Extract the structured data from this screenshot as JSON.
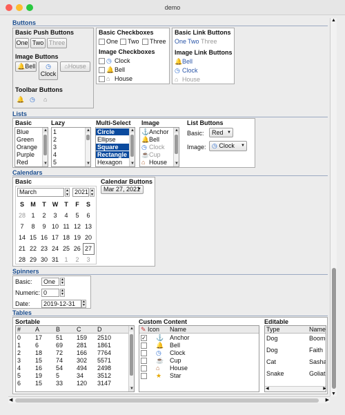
{
  "window": {
    "title": "demo"
  },
  "buttons": {
    "section": "Buttons",
    "push_title": "Basic Push Buttons",
    "one": "One",
    "two": "Two",
    "three": "Three",
    "image_title": "Image Buttons",
    "bell": "Bell",
    "clock": "Clock",
    "house": "House",
    "toolbar_title": "Toolbar Buttons",
    "check_title": "Basic Checkboxes",
    "c_one": "One",
    "c_two": "Two",
    "c_three": "Three",
    "imgcheck_title": "Image Checkboxes",
    "ic_clock": "Clock",
    "ic_bell": "Bell",
    "ic_house": "House",
    "link_title": "Basic Link Buttons",
    "l_one": "One",
    "l_two": "Two",
    "l_three": "Three",
    "imglink_title": "Image Link Buttons",
    "il_bell": "Bell",
    "il_clock": "Clock",
    "il_house": "House"
  },
  "lists": {
    "section": "Lists",
    "basic_title": "Basic",
    "basic_items": [
      "Blue",
      "Green",
      "Orange",
      "Purple",
      "Red"
    ],
    "lazy_title": "Lazy",
    "lazy_items": [
      "1",
      "2",
      "3",
      "4",
      "5"
    ],
    "multi_title": "Multi-Select",
    "multi_items": [
      "Circle",
      "Ellipse",
      "Square",
      "Rectangle",
      "Hexagon"
    ],
    "image_title": "Image",
    "image_items": [
      "Anchor",
      "Bell",
      "Clock",
      "Cup",
      "House"
    ],
    "buttons_title": "List Buttons",
    "basic_label": "Basic:",
    "basic_value": "Red",
    "image_label": "Image:",
    "image_value": "Clock"
  },
  "calendars": {
    "section": "Calendars",
    "basic_title": "Basic",
    "month": "March",
    "year": "2021",
    "days": [
      "S",
      "M",
      "T",
      "W",
      "T",
      "F",
      "S"
    ],
    "weeks": [
      [
        "28",
        "1",
        "2",
        "3",
        "4",
        "5",
        "6"
      ],
      [
        "7",
        "8",
        "9",
        "10",
        "11",
        "12",
        "13"
      ],
      [
        "14",
        "15",
        "16",
        "17",
        "18",
        "19",
        "20"
      ],
      [
        "21",
        "22",
        "23",
        "24",
        "25",
        "26",
        "27"
      ],
      [
        "28",
        "29",
        "30",
        "31",
        "1",
        "2",
        "3"
      ]
    ],
    "btn_title": "Calendar Buttons",
    "btn_value": "Mar 27, 2021"
  },
  "spinners": {
    "section": "Spinners",
    "basic_label": "Basic:",
    "basic_value": "One",
    "numeric_label": "Numeric:",
    "numeric_value": "0",
    "date_label": "Date:",
    "date_value": "2019-12-31"
  },
  "tables": {
    "section": "Tables",
    "sortable_title": "Sortable",
    "sortable_headers": [
      "#",
      "A",
      "B",
      "C",
      "D"
    ],
    "sortable_rows": [
      [
        "0",
        "17",
        "51",
        "159",
        "2510"
      ],
      [
        "1",
        "6",
        "69",
        "281",
        "1861"
      ],
      [
        "2",
        "18",
        "72",
        "166",
        "7764"
      ],
      [
        "3",
        "15",
        "74",
        "302",
        "5571"
      ],
      [
        "4",
        "16",
        "54",
        "494",
        "2498"
      ],
      [
        "5",
        "19",
        "5",
        "34",
        "3512"
      ],
      [
        "6",
        "15",
        "33",
        "120",
        "3147"
      ]
    ],
    "custom_title": "Custom Content",
    "custom_headers": [
      "Icon",
      "Name"
    ],
    "custom_rows": [
      {
        "checked": true,
        "name": "Anchor"
      },
      {
        "checked": false,
        "name": "Bell"
      },
      {
        "checked": false,
        "name": "Clock"
      },
      {
        "checked": false,
        "name": "Cup"
      },
      {
        "checked": false,
        "name": "House"
      },
      {
        "checked": false,
        "name": "Star"
      }
    ],
    "editable_title": "Editable",
    "editable_headers": [
      "Type",
      "Name"
    ],
    "editable_rows": [
      [
        "Dog",
        "Boomer"
      ],
      [
        "Dog",
        "Faith"
      ],
      [
        "Cat",
        "Sasha"
      ],
      [
        "Snake",
        "Goliath"
      ]
    ]
  }
}
